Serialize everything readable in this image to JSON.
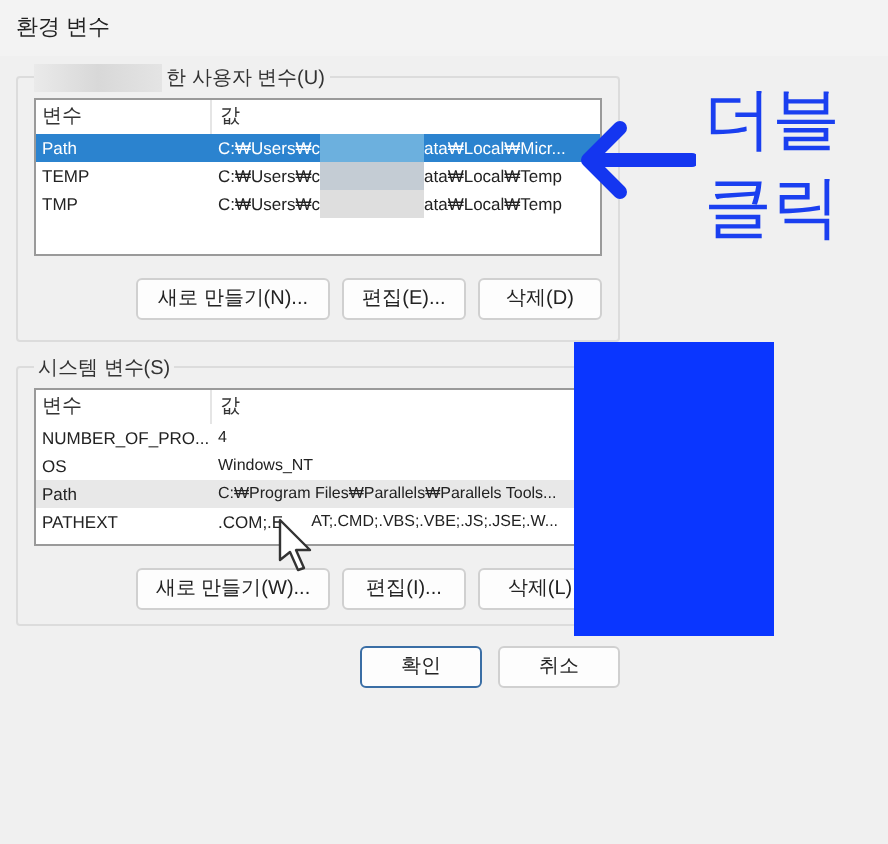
{
  "window": {
    "title": "환경 변수"
  },
  "user_variables": {
    "label": "한 사용자 변수(U)",
    "columns": [
      "변수",
      "값"
    ],
    "rows": [
      {
        "name": "Path",
        "value_start": "C:₩Users₩c",
        "value_end": "ata₩Local₩Micr...",
        "selected": true
      },
      {
        "name": "TEMP",
        "value_start": "C:₩Users₩c",
        "value_end": "ata₩Local₩Temp",
        "selected": false
      },
      {
        "name": "TMP",
        "value_start": "C:₩Users₩c",
        "value_end": "ata₩Local₩Temp",
        "selected": false
      }
    ],
    "buttons": [
      "새로 만들기(N)...",
      "편집(E)...",
      "삭제(D)"
    ]
  },
  "system_variables": {
    "label": "시스템 변수(S)",
    "columns": [
      "변수",
      "값"
    ],
    "rows": [
      {
        "name": "NUMBER_OF_PRO...",
        "value": "4",
        "selected": false,
        "hovered": false
      },
      {
        "name": "OS",
        "value": "Windows_NT",
        "selected": false,
        "hovered": false
      },
      {
        "name": "Path",
        "value": "C:₩Program Files₩Parallels₩Parallels Tools...",
        "selected": false,
        "hovered": true
      },
      {
        "name": "PATHEXT",
        "value_start": ".COM;.E",
        "value_end": "AT;.CMD;.VBS;.VBE;.JS;.JSE;.W...",
        "selected": false,
        "hovered": false
      }
    ],
    "buttons": [
      "새로 만들기(W)...",
      "편집(I)...",
      "삭제(L)"
    ]
  },
  "buttons": [
    {
      "label": "확인",
      "default": true
    },
    {
      "label": "취소",
      "default": false
    }
  ],
  "annotation": {
    "lines": [
      "더블",
      "클릭"
    ]
  }
}
